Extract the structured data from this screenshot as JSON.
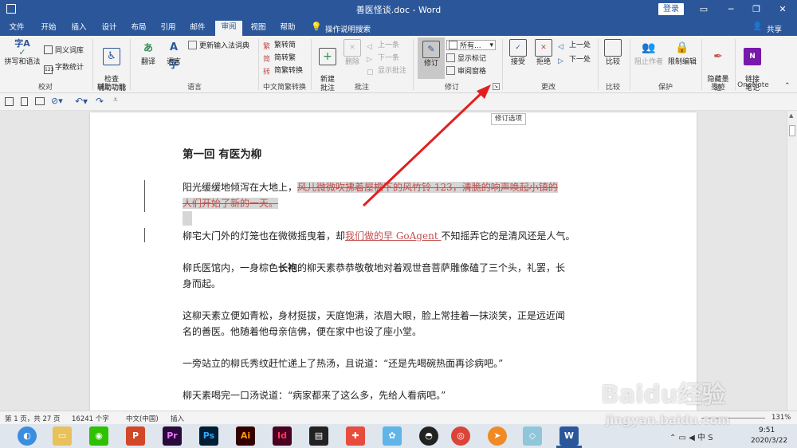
{
  "window": {
    "title": "善医怪谈.doc - Word",
    "login": "登录"
  },
  "tabs": [
    "文件",
    "开始",
    "插入",
    "设计",
    "布局",
    "引用",
    "邮件",
    "审阅",
    "视图",
    "帮助"
  ],
  "active_tab": "审阅",
  "tellme": "操作说明搜索",
  "share": "共享",
  "ribbon": {
    "proofing": {
      "spell": "拼写和语法",
      "thesaurus": "同义词库",
      "wordcount": "字数统计",
      "label": "校对"
    },
    "accessibility": {
      "check": "检查\n辅助功能",
      "label": "辅助功能"
    },
    "language": {
      "translate": "翻译",
      "language": "语言",
      "update_ime": "更新输入法词典",
      "label": "语言"
    },
    "chinese": {
      "to_trad": "繁转简",
      "to_simp": "简转繁",
      "convert": "简繁转换",
      "label": "中文简繁转换"
    },
    "comments": {
      "new": "新建\n批注",
      "delete": "删除",
      "prev": "上一条",
      "next": "下一条",
      "show": "显示批注",
      "label": "批注"
    },
    "tracking": {
      "track": "修订",
      "markup": "所有...",
      "show_markup": "显示标记",
      "pane": "审阅窗格",
      "label": "修订"
    },
    "changes": {
      "accept": "接受",
      "reject": "拒绝",
      "prev": "上一处",
      "next": "下一处",
      "label": "更改"
    },
    "compare": {
      "compare": "比较",
      "label": "比较"
    },
    "protect": {
      "block": "阻止作者",
      "restrict": "限制编辑",
      "label": "保护"
    },
    "ink": {
      "hide": "隐藏墨\n迹",
      "label": "墨迹"
    },
    "onenote": {
      "link": "链接\n笔记",
      "label": "OneNote"
    }
  },
  "tooltip": "修订选项",
  "document": {
    "heading": "第一回  有医为柳",
    "p1_normal": "阳光缓缓地倾泻在大地上，",
    "p1_deleted_1": "风儿微微吹拂着屋檐下的风竹铃 123，清脆的响声唤起小镇的",
    "p1_deleted_2": "人们开始了新的一天。",
    "p2_before": "柳宅大门外的灯笼也在微微摇曳着，却",
    "p2_inserted": "我们做的早 GoAgent ",
    "p2_after": "不知摇弄它的是清风还是人气。",
    "p3a_1": "柳氏医馆内，一身棕色",
    "p3a_bold": "长袍",
    "p3a_2": "的柳天素恭恭敬敬地对着观世音菩萨雕像磕了三个头，礼罢，长",
    "p3b": "身而起。",
    "p4a": "这柳天素立便如青松，身材挺拔，天庭饱满，浓眉大眼，脸上常挂着一抹淡笑，正是远近闻",
    "p4b": "名的善医。他随着他母亲信佛，便在家中也设了座小堂。",
    "p5": "一旁站立的柳氏秀纹赶忙递上了热汤，且说道：“还是先喝碗热面再诊病吧。”",
    "p6": "柳天素喝完一口汤说道：“病家都来了这么多，先给人看病吧。”"
  },
  "status": {
    "page": "第 1 页，共 27 页",
    "words": "16241 个字",
    "lang": "中文(中国)",
    "mode": "插入",
    "zoom": "131%"
  },
  "taskbar": {
    "time": "9:51",
    "date": "2020/3/22"
  },
  "watermark": "Baidu经验",
  "watermark_url": "jingyan.baidu.com",
  "colors": {
    "brand": "#2b579a",
    "revision": "#c0504d",
    "arrow": "#e02020"
  }
}
